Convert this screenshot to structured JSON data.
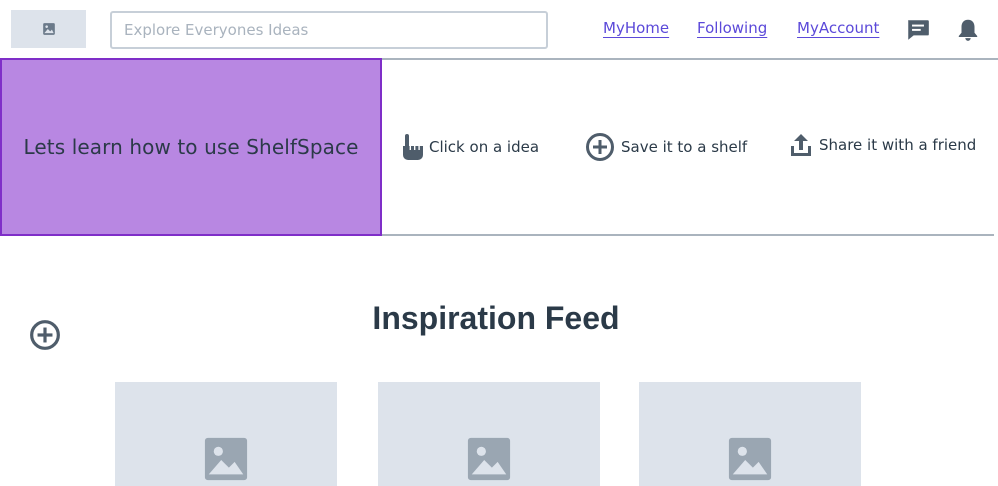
{
  "header": {
    "logo_icon": "image-icon",
    "search": {
      "placeholder": "Explore Everyones Ideas",
      "value": ""
    },
    "nav": [
      {
        "label": "MyHome"
      },
      {
        "label": "Following"
      },
      {
        "label": "MyAccount"
      }
    ],
    "icons": [
      "message-icon",
      "bell-icon"
    ],
    "link_color": "#5b49d9"
  },
  "banner": {
    "title": "Lets learn how to use ShelfSpace",
    "highlight_color": "#b887e2",
    "steps": [
      {
        "icon": "pointer-hand-icon",
        "label": "Click on a idea"
      },
      {
        "icon": "plus-circle-icon",
        "label": "Save it to a shelf"
      },
      {
        "icon": "share-upload-icon",
        "label": "Share it with a friend"
      }
    ]
  },
  "feed": {
    "title": "Inspiration Feed",
    "add_icon": "plus-circle-icon",
    "cards": [
      {
        "icon": "image-icon"
      },
      {
        "icon": "image-icon"
      },
      {
        "icon": "image-icon"
      }
    ]
  }
}
